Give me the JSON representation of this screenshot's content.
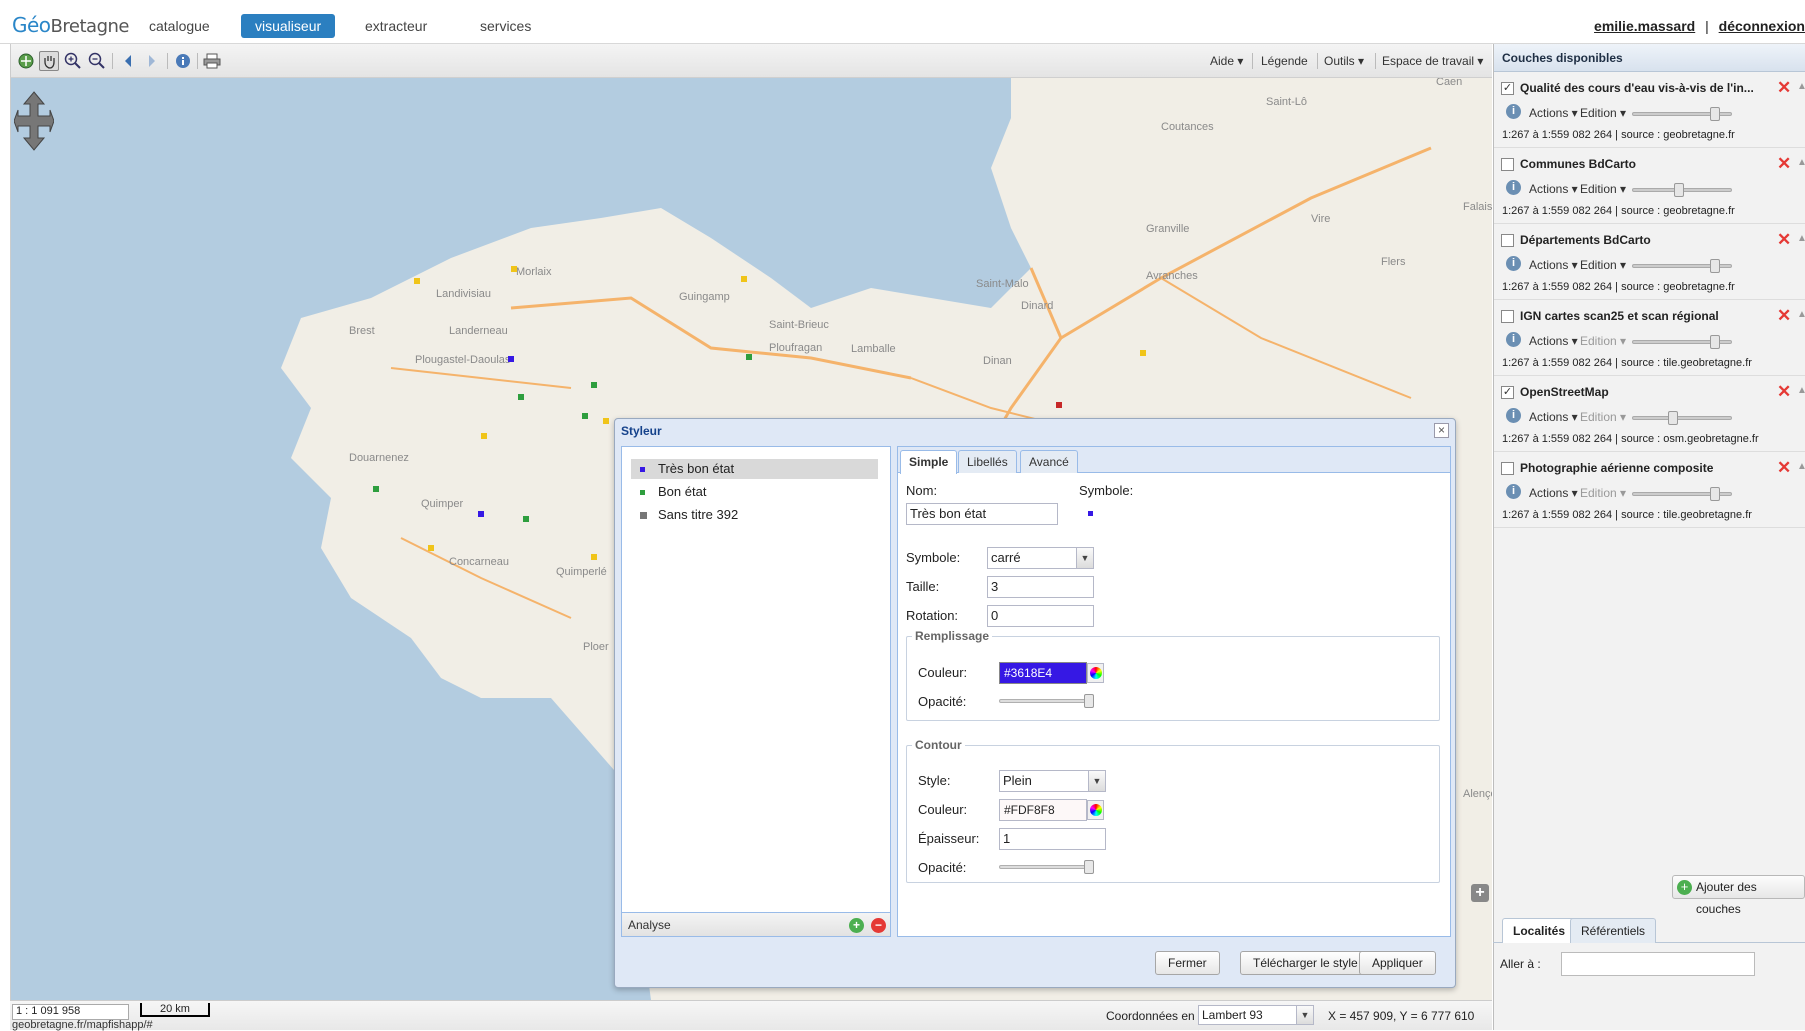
{
  "header": {
    "logo_a": "Géo",
    "logo_b": "Bretagne",
    "nav": [
      "catalogue",
      "visualiseur",
      "extracteur",
      "services"
    ],
    "active_nav": "visualiseur",
    "user": "emilie.massard",
    "separator": "|",
    "logout": "déconnexion"
  },
  "toolbar": {
    "menus": [
      "Aide ▾",
      "Légende",
      "Outils ▾",
      "Espace de travail ▾"
    ]
  },
  "map": {
    "labels": [
      "Brest",
      "Landerneau",
      "Landivisiau",
      "Morlaix",
      "Guingamp",
      "Saint-Brieuc",
      "Ploufragan",
      "Lamballe",
      "Dinan",
      "Saint-Malo",
      "Dinard",
      "Granville",
      "Avranches",
      "Coutances",
      "Saint-Lô",
      "Vire",
      "Flers",
      "Caen",
      "Plougastel-Daoulas",
      "Douarnenez",
      "Quimper",
      "Concarneau",
      "Quimperlé",
      "Ploer",
      "Falaise",
      "Alençon"
    ]
  },
  "panel": {
    "title": "Couches disponibles",
    "actions_label": "Actions ▾",
    "edition_label": "Edition ▾",
    "layers": [
      {
        "name": "Qualité des cours d'eau vis-à-vis de l'in...",
        "checked": true,
        "scale": "1:267 à 1:559 082 264  |  source : geobretagne.fr",
        "opacity": 0.88
      },
      {
        "name": "Communes BdCarto",
        "checked": false,
        "scale": "1:267 à 1:559 082 264  |  source : geobretagne.fr",
        "opacity": 0.47
      },
      {
        "name": "Départements BdCarto",
        "checked": false,
        "scale": "1:267 à 1:559 082 264  |  source : geobretagne.fr",
        "opacity": 0.88
      },
      {
        "name": "IGN cartes scan25 et scan régional",
        "checked": false,
        "scale": "1:267 à 1:559 082 264  |  source : tile.geobretagne.fr",
        "opacity": 0.88
      },
      {
        "name": "OpenStreetMap",
        "checked": true,
        "scale": "1:267 à 1:559 082 264  |  source : osm.geobretagne.fr",
        "opacity": 0.4
      },
      {
        "name": "Photographie aérienne composite",
        "checked": false,
        "scale": "1:267 à 1:559 082 264  |  source : tile.geobretagne.fr",
        "opacity": 0.88
      }
    ],
    "add_layers": "Ajouter des couches",
    "tabs": [
      "Localités",
      "Référentiels"
    ],
    "goto_label": "Aller à :"
  },
  "styleur": {
    "title": "Styleur",
    "rules": [
      {
        "label": "Très bon état",
        "color": "#3618E4"
      },
      {
        "label": "Bon état",
        "color": "#2e9e3e"
      },
      {
        "label": "Sans titre 392",
        "color": "#777777"
      }
    ],
    "analyse": "Analyse",
    "tabs": [
      "Simple",
      "Libellés",
      "Avancé"
    ],
    "nom_label": "Nom:",
    "nom_value": "Très bon état",
    "symbole_label": "Symbole:",
    "symbole_type_label": "Symbole:",
    "symbole_type": "carré",
    "taille_label": "Taille:",
    "taille": "3",
    "rotation_label": "Rotation:",
    "rotation": "0",
    "fill_legend": "Remplissage",
    "couleur_label": "Couleur:",
    "fill_color": "#3618E4",
    "opacite_label": "Opacité:",
    "stroke_legend": "Contour",
    "style_label": "Style:",
    "stroke_style": "Plein",
    "stroke_color": "#FDF8F8",
    "epaisseur_label": "Épaisseur:",
    "epaisseur": "1",
    "buttons": [
      "Fermer",
      "Télécharger le style",
      "Appliquer"
    ]
  },
  "status": {
    "scale": "1 : 1 091 958",
    "scalebar": "20 km",
    "url": "geobretagne.fr/mapfishapp/#",
    "coords_label": "Coordonnées en",
    "projection": "Lambert 93",
    "xy": "X = 457 909, Y = 6 777 610"
  }
}
